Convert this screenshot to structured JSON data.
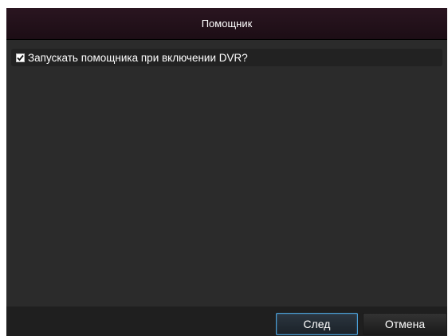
{
  "dialog": {
    "title": "Помощник"
  },
  "options": {
    "start_wizard": {
      "label": "Запускать помощника при включении DVR?",
      "checked": true
    }
  },
  "footer": {
    "next_label": "След",
    "cancel_label": "Отмена"
  },
  "colors": {
    "titlebar": "#1c0d15",
    "panel": "#2b2b2b",
    "focus_border": "#4aa0d8"
  }
}
